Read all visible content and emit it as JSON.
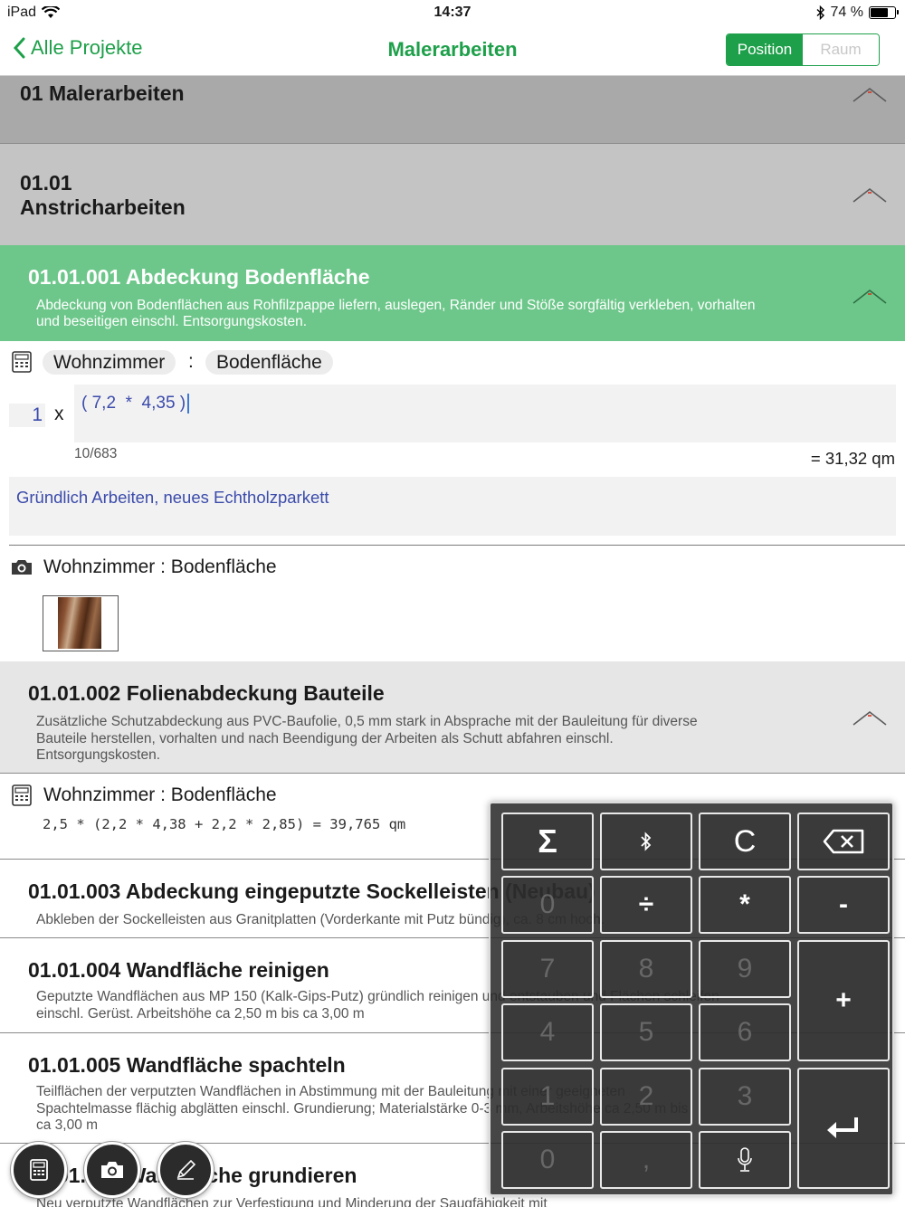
{
  "status": {
    "device": "iPad",
    "time": "14:37",
    "battery": "74 %",
    "battery_level": 0.74
  },
  "nav": {
    "back_label": "Alle Projekte",
    "title": "Malerarbeiten",
    "segments": [
      "Position",
      "Raum"
    ],
    "selected_segment": "Position"
  },
  "sections": {
    "s1": "01 Malerarbeiten",
    "s2_number": "01.01",
    "s2_title": "Anstricharbeiten"
  },
  "active": {
    "title": "01.01.001 Abdeckung Bodenfläche",
    "desc": "Abdeckung von Bodenflächen aus Rohfilzpappe liefern, auslegen, Ränder und Stöße sorgfältig verkleben, vorhalten und beseitigen einschl. Entsorgungskosten.",
    "room": "Wohnzimmer",
    "separator": ":",
    "area": "Bodenfläche",
    "quantity": "1",
    "times": "x",
    "formula": "( 7,2  *  4,35 )",
    "counter": "10/683",
    "result": "= 31,32 qm",
    "note": "Gründlich Arbeiten, neues Echtholzparkett",
    "photo_label": "Wohnzimmer : Bodenfläche"
  },
  "positions": [
    {
      "title": "01.01.002 Folienabdeckung Bauteile",
      "desc": "Zusätzliche Schutzabdeckung aus PVC-Baufolie, 0,5 mm stark in Absprache mit der Bauleitung für diverse Bauteile herstellen, vorhalten und nach Beendigung der Arbeiten als Schutt abfahren einschl. Entsorgungskosten.",
      "meas_label": "Wohnzimmer : Bodenfläche",
      "meas_expr": "2,5 * (2,2 * 4,38 + 2,2 * 2,85) = 39,765 qm"
    },
    {
      "title": "01.01.003 Abdeckung eingeputzte Sockelleisten (Neubau)",
      "desc": "Abkleben der Sockelleisten aus Granitplatten (Vorderkante mit Putz bündig), ca. 8 cm hoch."
    },
    {
      "title": "01.01.004 Wandfläche reinigen",
      "desc": "Geputzte Wandflächen aus MP 150 (Kalk-Gips-Putz) gründlich reinigen und entstauben und Flächen schleifen einschl. Gerüst. Arbeitshöhe ca 2,50 m bis ca 3,00 m"
    },
    {
      "title": "01.01.005 Wandfläche spachteln",
      "desc": "Teilflächen der verputzten Wandflächen in Abstimmung mit der Bauleitung mit einer geeigneten Spachtelmasse flächig abglätten einschl. Grundierung; Materialstärke 0-3 mm, Arbeitshöhe ca 2,50 m bis ca 3,00 m"
    },
    {
      "title": "01.01.006 Wandfläche grundieren",
      "desc": "Neu verputzte Wandflächen zur Verfestigung und Minderung der Saugfähigkeit mit"
    }
  ],
  "fabs": [
    "calculator-icon",
    "camera-icon",
    "pencil-icon"
  ],
  "keypad": {
    "keys": {
      "sum": "Σ",
      "bt": "bluetooth-icon",
      "clear": "C",
      "back": "backspace-icon",
      "k0a": "0",
      "div": "÷",
      "mul": "*",
      "minus": "-",
      "k7": "7",
      "k8": "8",
      "k9": "9",
      "plus": "+",
      "k4": "4",
      "k5": "5",
      "k6": "6",
      "k1": "1",
      "k2": "2",
      "k3": "3",
      "enter": "return-icon",
      "k0": "0",
      "comma": ",",
      "mic": "microphone-icon"
    }
  },
  "colors": {
    "accent": "#1ea04a",
    "active_row": "#6dc78a",
    "input_text": "#3b4bab"
  }
}
